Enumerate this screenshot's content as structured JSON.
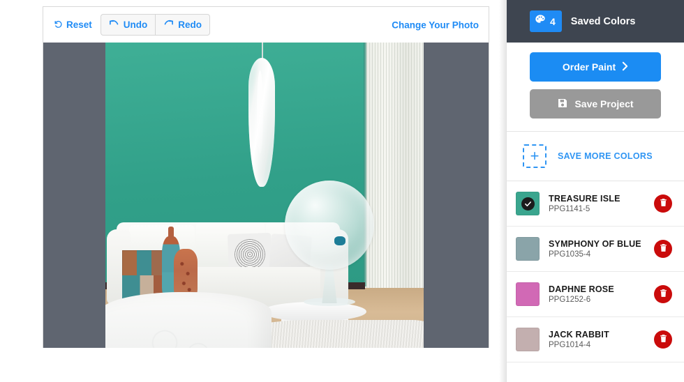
{
  "toolbar": {
    "reset_label": "Reset",
    "reset_icon": "rotate-ccw-icon",
    "undo_label": "Undo",
    "undo_icon": "undo-arrow-icon",
    "redo_label": "Redo",
    "redo_icon": "redo-arrow-icon",
    "change_photo_label": "Change Your Photo"
  },
  "photo": {
    "alt": "living room with teal painted accent wall, white sofa, glass pendant lamp and glass globe vase",
    "wall_color": "#31a089",
    "letterbox_color": "#5f6570"
  },
  "sidebar": {
    "header": {
      "badge_count": "4",
      "badge_icon": "palette-icon",
      "badge_color": "#1f8bf5",
      "title": "Saved Colors",
      "background": "#3e4550"
    },
    "actions": {
      "order_paint_label": "Order Paint",
      "order_paint_icon": "chevron-right-icon",
      "order_paint_color": "#1b8cf3",
      "save_project_label": "Save Project",
      "save_project_icon": "floppy-disk-icon",
      "save_project_color": "#999999"
    },
    "save_more": {
      "icon": "plus-icon",
      "label": "SAVE MORE COLORS",
      "accent": "#2f95f3"
    },
    "colors": [
      {
        "name": "TREASURE ISLE",
        "code": "PPG1141-5",
        "hex": "#3aa58e",
        "selected": true,
        "delete_icon": "trash-icon"
      },
      {
        "name": "SYMPHONY OF BLUE",
        "code": "PPG1035-4",
        "hex": "#8aa4a9",
        "selected": false,
        "delete_icon": "trash-icon"
      },
      {
        "name": "DAPHNE ROSE",
        "code": "PPG1252-6",
        "hex": "#d169b5",
        "selected": false,
        "delete_icon": "trash-icon"
      },
      {
        "name": "JACK RABBIT",
        "code": "PPG1014-4",
        "hex": "#c3afaf",
        "selected": false,
        "delete_icon": "trash-icon"
      }
    ]
  }
}
